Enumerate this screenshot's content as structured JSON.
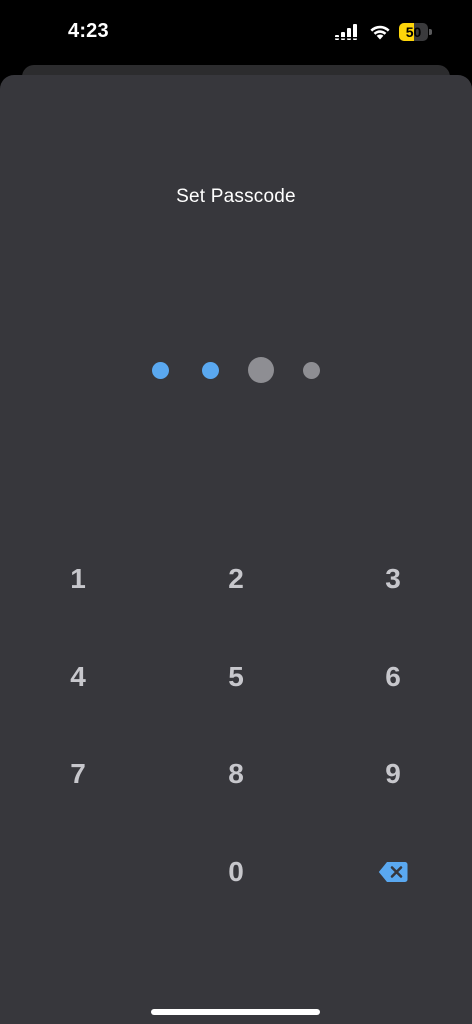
{
  "status_bar": {
    "time": "4:23",
    "battery_level": "50",
    "battery_fraction": 0.5,
    "battery_color": "#ffd60a"
  },
  "passcode": {
    "title": "Set Passcode",
    "length": 4,
    "digits_entered": 2,
    "filled_color": "#5aa8f0",
    "empty_color": "#8e8e93"
  },
  "keypad": {
    "keys": [
      "1",
      "2",
      "3",
      "4",
      "5",
      "6",
      "7",
      "8",
      "9",
      "0"
    ],
    "delete_icon": "delete-backspace-icon",
    "delete_color": "#5aa8f0"
  }
}
